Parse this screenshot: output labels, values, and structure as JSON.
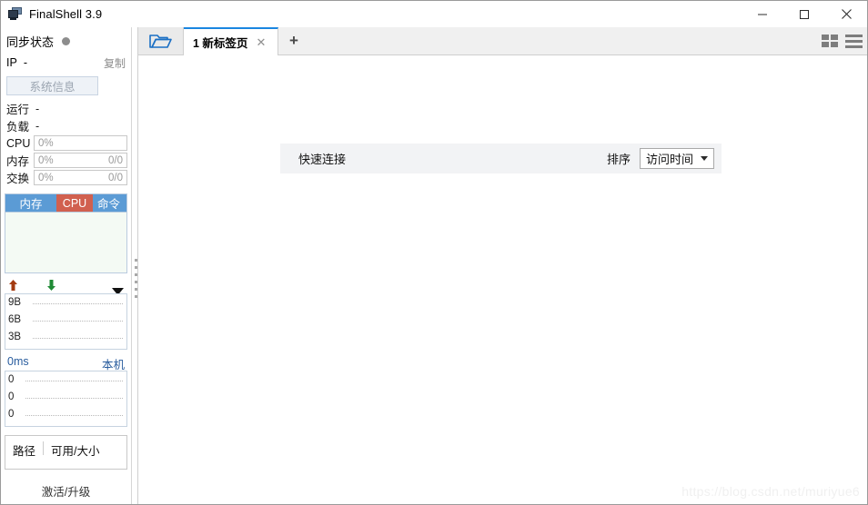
{
  "window": {
    "title": "FinalShell 3.9",
    "icon": "computer-icon",
    "controls": {
      "minimize": "minimize-icon",
      "maximize": "maximize-icon",
      "close": "close-icon"
    }
  },
  "sidebar": {
    "sync": {
      "label": "同步状态",
      "status_dot_color": "#8d8d8d"
    },
    "ip": {
      "key": "IP",
      "value": "-",
      "copy_label": "复制"
    },
    "system_info_button": "系统信息",
    "stats": [
      {
        "key": "运行",
        "value": "-",
        "type": "text"
      },
      {
        "key": "负载",
        "value": "-",
        "type": "text"
      },
      {
        "key": "CPU",
        "percent": "0%",
        "right": "",
        "type": "meter"
      },
      {
        "key": "内存",
        "percent": "0%",
        "right": "0/0",
        "type": "meter"
      },
      {
        "key": "交换",
        "percent": "0%",
        "right": "0/0",
        "type": "meter"
      }
    ],
    "mini_tabs": [
      {
        "label": "内存",
        "color": "#5b9bd5"
      },
      {
        "label": "CPU",
        "color": "#d1604f"
      },
      {
        "label": "命令",
        "color": "#5b9bd5"
      }
    ],
    "network": {
      "upload_icon": "arrow-up-icon",
      "download_icon": "arrow-down-icon",
      "menu_icon": "caret-down-icon",
      "y_labels": [
        "9B",
        "6B",
        "3B"
      ]
    },
    "ping": {
      "latency": "0ms",
      "host": "本机",
      "y_labels": [
        "0",
        "0",
        "0"
      ]
    },
    "disk": {
      "col_path": "路径",
      "col_size": "可用/大小"
    },
    "activate_link": "激活/升级"
  },
  "tabbar": {
    "folder_icon": "folder-open-icon",
    "tabs": [
      {
        "label": "1 新标签页",
        "close_icon": "close-icon",
        "active": true
      }
    ],
    "add_tab": "+",
    "view_grid_icon": "grid-view-icon",
    "view_list_icon": "list-view-icon"
  },
  "main": {
    "quick_connect": {
      "title": "快速连接",
      "sort_label": "排序",
      "sort_value": "访问时间",
      "caret_icon": "caret-down-icon"
    },
    "watermark": "https://blog.csdn.net/muriyue6"
  }
}
